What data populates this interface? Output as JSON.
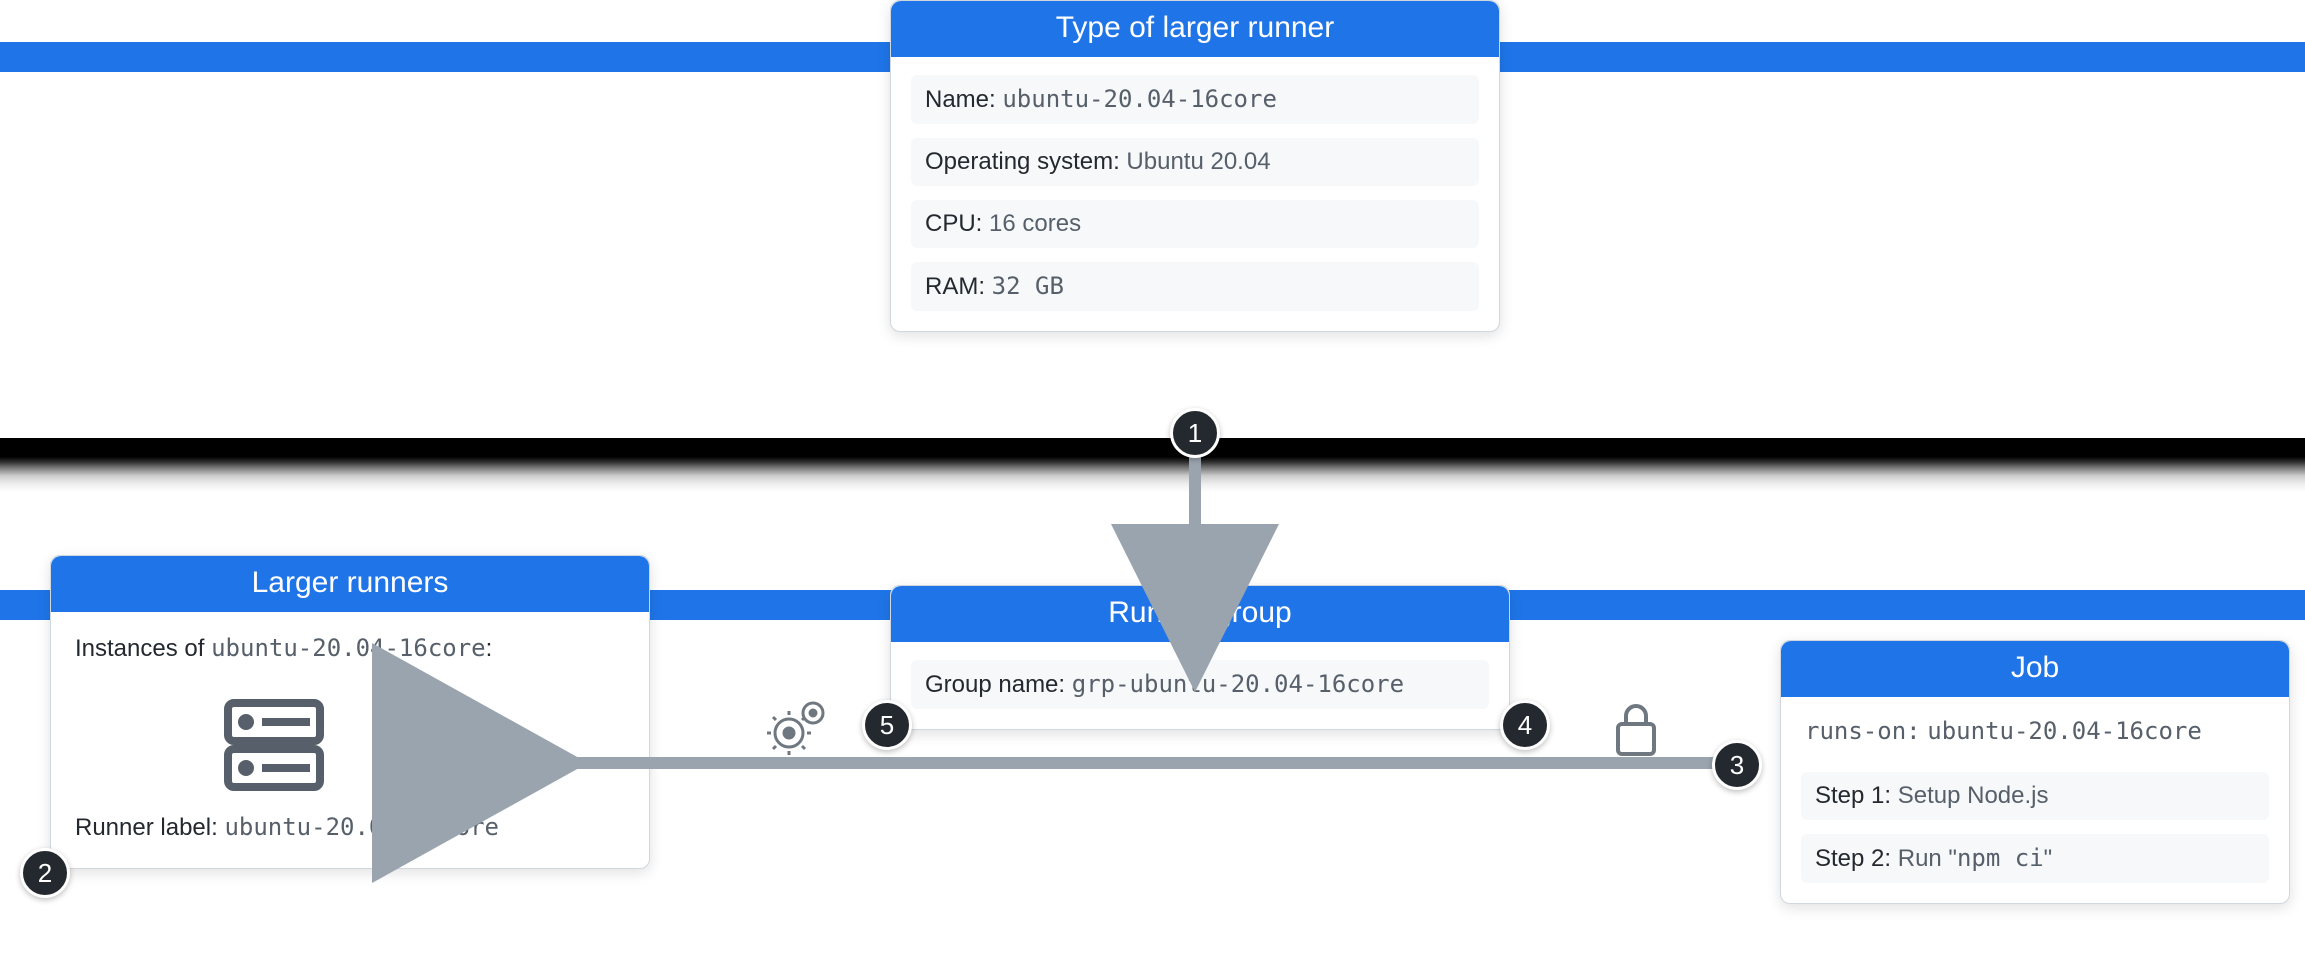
{
  "colors": {
    "accent": "#1f75e8",
    "badge": "#24292f",
    "muted": "#57606a",
    "rowbg": "#f6f8fa"
  },
  "bars": {
    "top": true,
    "mid": true
  },
  "type_card": {
    "title": "Type of larger runner",
    "name_label": "Name:",
    "name_value": "ubuntu-20.04-16core",
    "os_label": "Operating system:",
    "os_value": "Ubuntu 20.04",
    "cpu_label": "CPU:",
    "cpu_value": "16 cores",
    "ram_label": "RAM:",
    "ram_value": "32 GB"
  },
  "larger_runners_card": {
    "title": "Larger runners",
    "instances_label": "Instances of",
    "instances_value": "ubuntu-20.04-16core",
    "instances_suffix": ":",
    "runner_label_label": "Runner label:",
    "runner_label_value": "ubuntu-20.04-16core"
  },
  "runner_group_card": {
    "title": "Runner group",
    "group_name_label": "Group name:",
    "group_name_value": "grp-ubuntu-20.04-16core"
  },
  "job_card": {
    "title": "Job",
    "runs_on_label": "runs-on:",
    "runs_on_value": "ubuntu-20.04-16core",
    "step1_label": "Step 1:",
    "step1_value": "Setup Node.js",
    "step2_label": "Step 2:",
    "step2_value_prefix": "Run \"",
    "step2_cmd": "npm ci",
    "step2_value_suffix": "\""
  },
  "badges": {
    "b1": "1",
    "b2": "2",
    "b3": "3",
    "b4": "4",
    "b5": "5"
  }
}
